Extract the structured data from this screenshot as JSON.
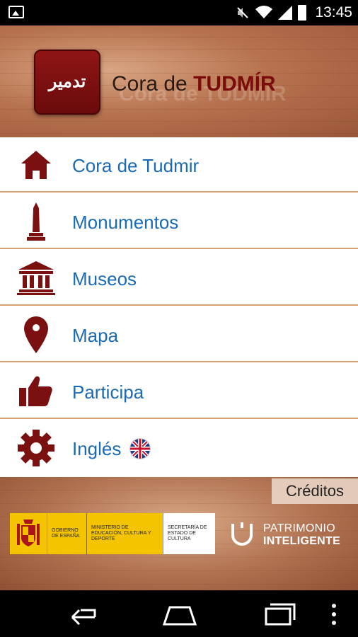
{
  "status_bar": {
    "time": "13:45",
    "icons": [
      "gallery-notification-icon",
      "mute-icon",
      "wifi-icon",
      "signal-icon",
      "battery-icon"
    ]
  },
  "header": {
    "logo_text": "تدمير",
    "title_prefix": "Cora de",
    "title_emphasis": "TUDMÍR"
  },
  "menu": {
    "items": [
      {
        "label": "Cora de Tudmir",
        "icon": "home-icon"
      },
      {
        "label": "Monumentos",
        "icon": "monument-icon"
      },
      {
        "label": "Museos",
        "icon": "museum-icon"
      },
      {
        "label": "Mapa",
        "icon": "map-pin-icon"
      },
      {
        "label": "Participa",
        "icon": "thumbs-up-icon"
      },
      {
        "label": "Inglés",
        "icon": "gear-icon"
      }
    ]
  },
  "footer": {
    "credits_label": "Créditos",
    "gov_col1": "GOBIERNO DE ESPAÑA",
    "gov_col2": "MINISTERIO DE EDUCACIÓN, CULTURA Y DEPORTE",
    "gov_col3": "SECRETARÍA DE ESTADO DE CULTURA",
    "brand_line1": "PATRIMONIO",
    "brand_line2": "INTELIGENTE"
  },
  "colors": {
    "accent_dark_red": "#7a0c0c",
    "link_blue": "#1a6ab6",
    "divider": "#d8a070"
  }
}
